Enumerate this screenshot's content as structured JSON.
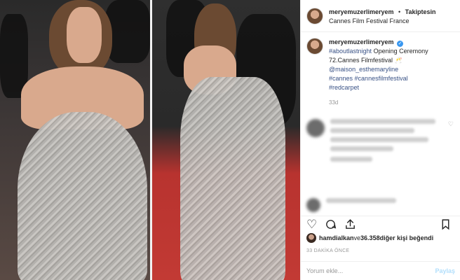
{
  "post": {
    "username": "meryemuzerlimeryem",
    "follow_label": "Takiptesin",
    "location": "Cannes Film Festival France",
    "separator": "•"
  },
  "caption": {
    "username": "meryemuzerlimeryem",
    "verified_icon": "verified-badge-icon",
    "tag1": "#aboutlastnight",
    "text1": " Opening Ceremony 72.Cannes Filmfestival ",
    "emoji": "🥂",
    "mention": "@maison_esthemaryline",
    "tag2": "#cannes",
    "tag3": "#cannesfilmfestival",
    "tag4": "#redcarpet",
    "time": "33d"
  },
  "actions": {
    "like_icon": "heart-icon",
    "comment_icon": "comment-icon",
    "share_icon": "share-icon",
    "save_icon": "bookmark-icon"
  },
  "likes": {
    "user": "hamdialkan",
    "text_mid": " ve ",
    "count": "36.358",
    "text_end": " diğer kişi beğendi"
  },
  "timestamp": "33 DAKİKA ÖNCE",
  "comment_input": {
    "placeholder": "Yorum ekle...",
    "post_label": "Paylaş"
  },
  "colors": {
    "link": "#385185",
    "verified": "#3897f0",
    "muted": "#999999",
    "post_disabled": "#b2dffc"
  }
}
